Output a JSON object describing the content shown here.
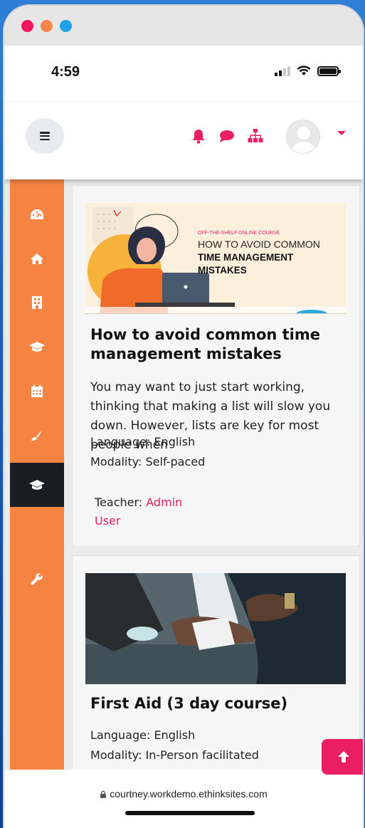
{
  "window": {
    "dots": [
      "red",
      "orange",
      "blue"
    ]
  },
  "status": {
    "time": "4:59"
  },
  "header": {
    "icons": [
      "menu-icon",
      "bell-icon",
      "chat-icon",
      "sitemap-icon",
      "avatar-icon",
      "caret-down-icon"
    ],
    "accent": "#e91e63"
  },
  "sidebar": {
    "color": "#f58443",
    "items": [
      "dashboard-icon",
      "home-icon",
      "building-icon",
      "graduation-cap-icon",
      "calendar-icon",
      "brush-icon",
      "graduation-cap-icon",
      "wrench-icon"
    ],
    "active_index": 6
  },
  "courses": [
    {
      "banner": {
        "kicker": "OFF-THE-SHELF ONLINE COURSE",
        "line1": "HOW TO AVOID COMMON",
        "line2": "TIME MANAGEMENT",
        "line3": "MISTAKES"
      },
      "title": "How to avoid common time management mistakes",
      "description": "You may want to just start working, thinking that making a list will slow you down. However, lists are key for most people when",
      "language": "Language: English",
      "modality": "Modality: Self-paced",
      "teacher_label": "Teacher: ",
      "teacher_name": "Admin User"
    },
    {
      "title": "First Aid (3 day course)",
      "language": "Language: English",
      "modality": "Modality: In-Person facilitated"
    }
  ],
  "browser": {
    "url": "courtney.workdemo.ethinksites.com"
  }
}
